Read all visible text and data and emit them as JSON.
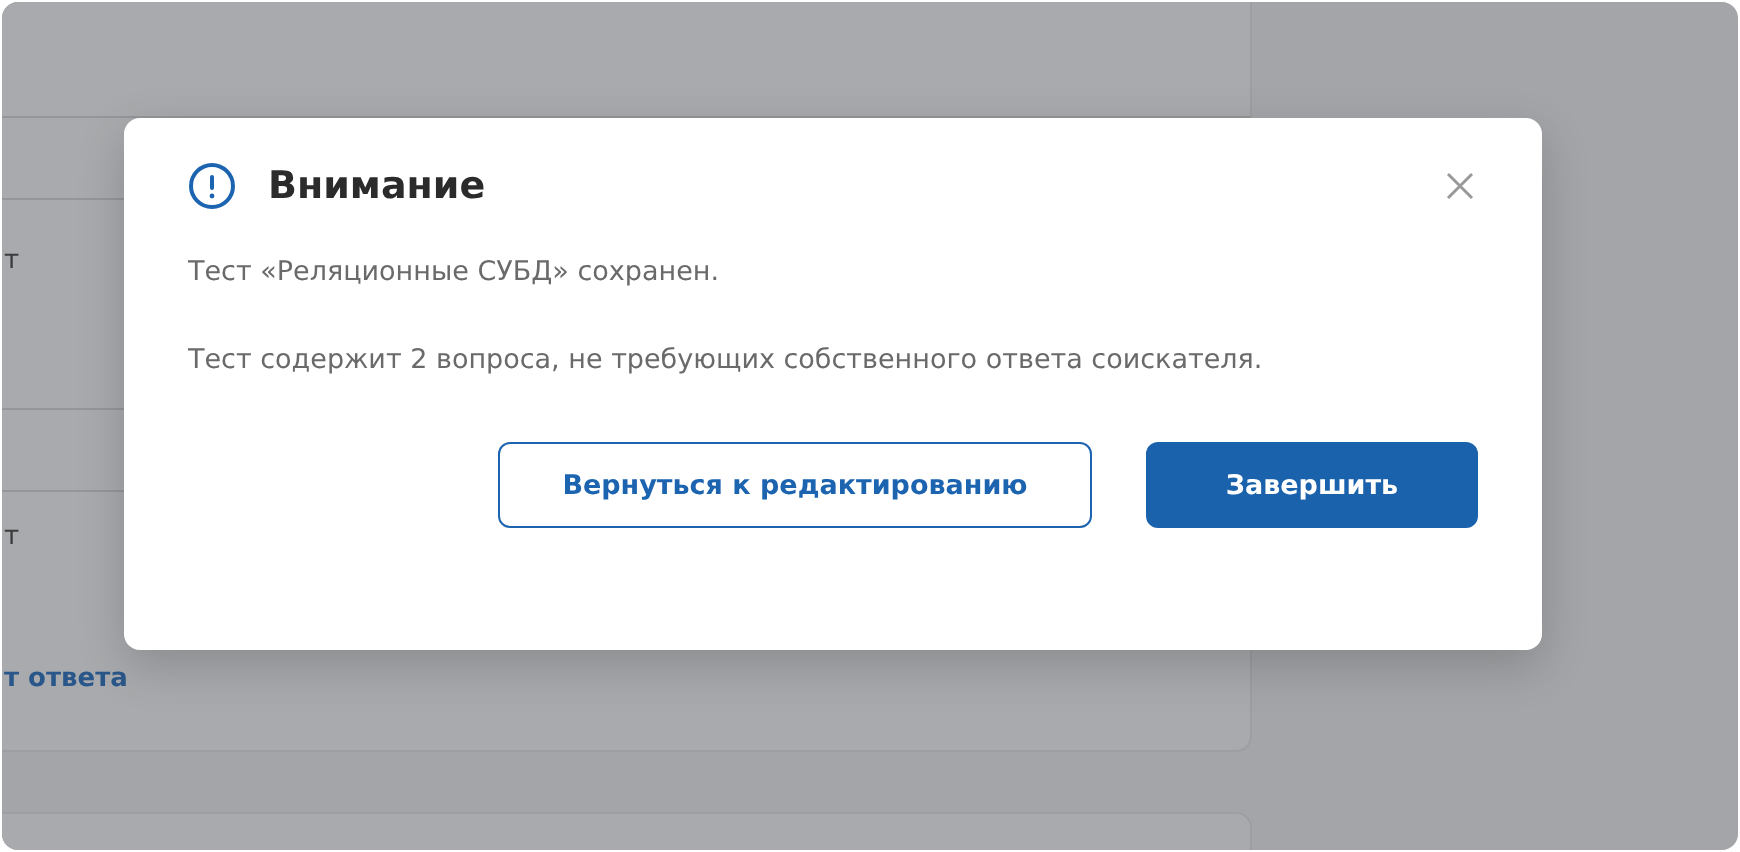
{
  "background": {
    "rows": [
      {
        "text": "т",
        "kind": "plain"
      },
      {
        "text": "т",
        "kind": "plain"
      },
      {
        "text": "т ответа",
        "kind": "link"
      }
    ]
  },
  "dialog": {
    "title": "Внимание",
    "paragraphs": [
      "Тест «Реляционные СУБД» сохранен.",
      "Тест содержит 2 вопроса, не требующих собственного ответа соискателя."
    ],
    "buttons": [
      {
        "label": "Вернуться к редактированию",
        "kind": "secondary"
      },
      {
        "label": "Завершить",
        "kind": "primary"
      }
    ]
  }
}
